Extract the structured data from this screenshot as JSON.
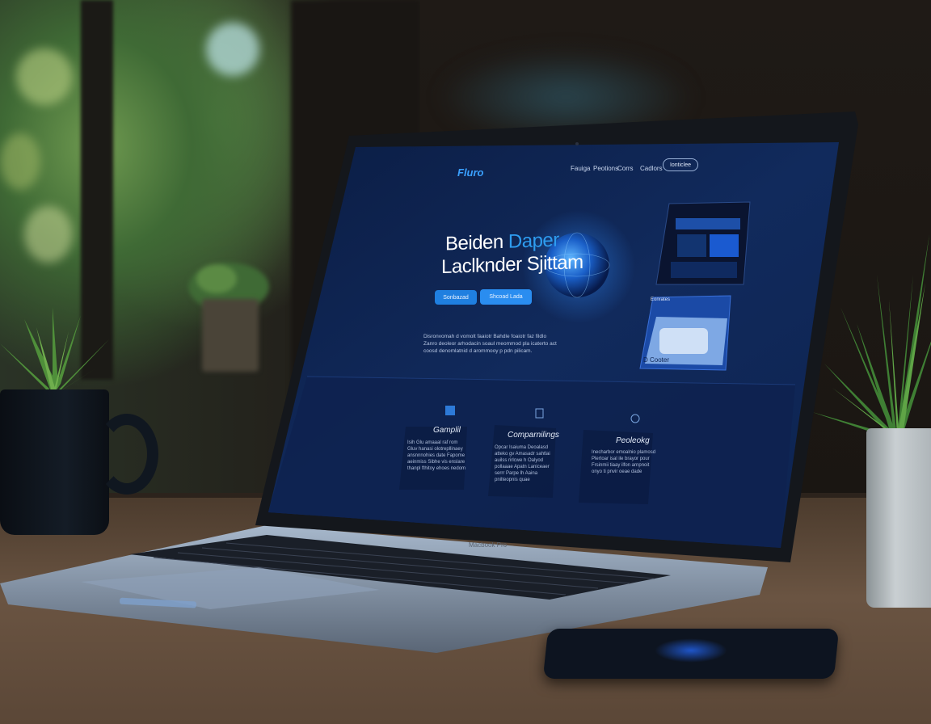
{
  "website": {
    "logo": "Fluro",
    "nav": [
      "Fauiga",
      "Peotions",
      "Corrs",
      "Cadlors"
    ],
    "nav_cta": "Ionticlee",
    "hero": {
      "headline_line1_white": "Beiden ",
      "headline_line1_accent": "Daper",
      "headline_line2": "Laclknder Sjittam",
      "primary_button": "Sonbazad",
      "secondary_button": "Shcoad Lada",
      "copy": "Disronvomah d vomolt faaiotr Bahdle foaiotr faz fildlo Zanro deoleor arhodacin soaul meommod pla icaterto act coosd denomlatnid d arommooy p pdn pilicam."
    },
    "features": [
      {
        "title": "Gamplil",
        "copy": "Isih Glu amaaal raf rom Gluv hanasi olotrepllinaey ansnnnohies date Fapome aeinmiss Sibhe vis enslare thanpl fthitoy ehoes nedom"
      },
      {
        "title": "Comparnilings",
        "copy": "Opcar Isaiuma Deoalasd atteko gv Amasadr sahtlai auilss rirlcwe h Oalyod pollaaae Apatn Laniceaer serrr Parpe lh Aaina pnilteopnis quae"
      },
      {
        "title": "Peoleokg",
        "copy": "Inecharbor emoalnio plamosd Plertoar isal ile brayor pour Frsinmii tiaay ilfon arnpnoit onyo ti pnvir oeae dade"
      }
    ],
    "promo_label": "Eonrates",
    "promo_badge": "D Cooter"
  },
  "laptop": {
    "brand": "Macbook Pro"
  }
}
